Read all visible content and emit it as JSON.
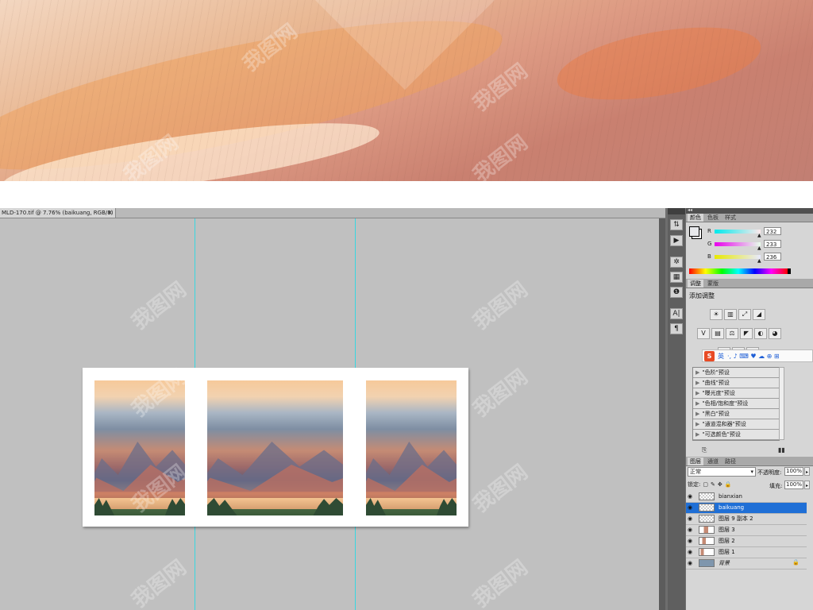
{
  "document_tab": {
    "title": "MLD-170.tif @ 7.76% (baikuang, RGB/8)",
    "close": "×"
  },
  "watermark_text": "我图网",
  "color_panel": {
    "tabs": [
      "颜色",
      "色板",
      "样式"
    ],
    "channels": [
      {
        "label": "R",
        "value": "232",
        "gradient": "#e4ffff"
      },
      {
        "label": "G",
        "value": "233",
        "gradient": "#ff4ed6"
      },
      {
        "label": "B",
        "value": "236",
        "gradient": "#e8e8a0"
      }
    ],
    "foreground": "#e8e9ec",
    "background": "#ffffff"
  },
  "adjustments_panel": {
    "tabs": [
      "调整",
      "蒙版"
    ],
    "title": "添加调整",
    "icons_row1": [
      "☀",
      "▥",
      "⤢",
      "◢"
    ],
    "icons_row2": [
      "V",
      "▤",
      "⚖",
      "◤",
      "◐",
      "◕"
    ],
    "icons_row3": [
      "◧",
      "◩",
      "◪"
    ],
    "presets": [
      "\"色阶\"预设",
      "\"曲线\"预设",
      "\"曝光度\"预设",
      "\"色相/饱和度\"预设",
      "\"黑白\"预设",
      "\"通道混和器\"预设",
      "\"可选颜色\"预设"
    ]
  },
  "ime_toolbar": {
    "logo": "S",
    "lang": "英",
    "icons": "·, ♪ ⌨ ♥ ☁ ⊕ ⊞"
  },
  "layers_panel": {
    "tabs": [
      "图层",
      "通道",
      "路径"
    ],
    "blend_mode": "正常",
    "opacity_label": "不透明度:",
    "opacity": "100%",
    "lock_label": "锁定:",
    "fill_label": "填充:",
    "fill": "100%",
    "layers": [
      {
        "name": "bianxian",
        "selected": false
      },
      {
        "name": "baikuang",
        "selected": true
      },
      {
        "name": "图层 9 副本 2",
        "selected": false
      },
      {
        "name": "图层 3",
        "selected": false
      },
      {
        "name": "图层 2",
        "selected": false
      },
      {
        "name": "图层 1",
        "selected": false
      },
      {
        "name": "背景",
        "selected": false
      }
    ]
  },
  "tools": {
    "icons": [
      "⇅",
      "▶",
      "✲",
      "▦",
      "❶",
      "A|",
      "¶"
    ]
  }
}
